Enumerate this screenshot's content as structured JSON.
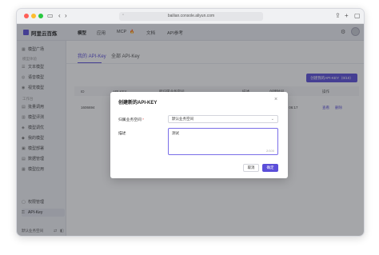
{
  "browser": {
    "url": "bailian.console.aliyun.com",
    "icons": [
      "sidebar-toggle-icon",
      "back-icon",
      "forward-icon",
      "shield-icon",
      "share-icon",
      "new-tab-icon",
      "tabs-icon"
    ]
  },
  "topnav": {
    "logo": "阿里云百炼",
    "items": [
      "模型",
      "应用",
      "MCP",
      "文档",
      "API参考"
    ],
    "mcp_badge": "🔥"
  },
  "sidebar": {
    "items": [
      {
        "label": "模型广场",
        "icon": "grid-icon"
      },
      {
        "group": "模型体验"
      },
      {
        "label": "文本模型",
        "icon": "text-icon"
      },
      {
        "label": "语音模型",
        "icon": "voice-icon"
      },
      {
        "label": "视觉模型",
        "icon": "eye-icon"
      },
      {
        "group": "工作台"
      },
      {
        "label": "批量调用",
        "icon": "batch-icon"
      },
      {
        "label": "模型评测",
        "icon": "chart-icon"
      },
      {
        "label": "模型调优",
        "icon": "tune-icon"
      },
      {
        "label": "我的模型",
        "icon": "cube-icon"
      },
      {
        "label": "模型部署",
        "icon": "deploy-icon"
      },
      {
        "label": "数据管理",
        "icon": "database-icon"
      },
      {
        "label": "模型应用",
        "icon": "app-icon"
      }
    ],
    "bottom": [
      {
        "label": "权限管理",
        "icon": "lock-icon"
      },
      {
        "label": "API-Key",
        "icon": "key-icon"
      }
    ],
    "footer_label": "默认业务空间"
  },
  "main": {
    "tabs": [
      "我的 API-Key",
      "全部 API-Key"
    ],
    "create_button": "创建我的API-KEY（0/10）",
    "columns": [
      "ID",
      "API KEY",
      "所归属业务空间",
      "描述",
      "创建时间",
      "操作"
    ],
    "row": {
      "id": "1606694",
      "created": "2025-03-15 06:17",
      "actions": [
        "查看",
        "删除"
      ]
    }
  },
  "modal": {
    "title": "创建新的API-KEY",
    "space_label": "归属业务空间",
    "required_mark": "*",
    "space_value": "默认业务空间",
    "desc_label": "描述",
    "desc_value": "测试",
    "counter": "2/100",
    "cancel": "取消",
    "confirm": "确定"
  },
  "colors": {
    "accent": "#5b4ed9",
    "overlay": "rgba(40,42,50,0.42)"
  }
}
